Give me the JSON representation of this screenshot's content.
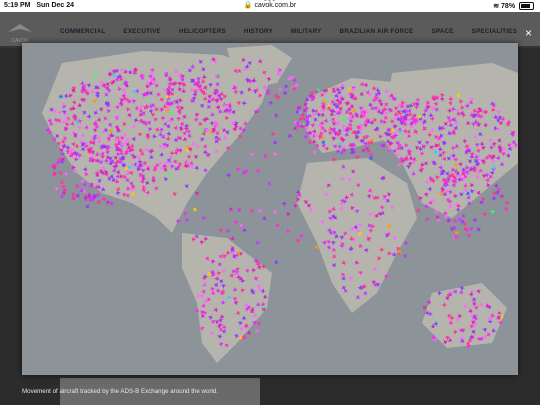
{
  "status_bar": {
    "time": "5:19 PM",
    "date": "Sun Dec 24",
    "url": "cavok.com.br",
    "battery": "78%",
    "battery_level": 0.78
  },
  "site": {
    "logo_text": "CAVOK",
    "nav": [
      "COMMERCIAL",
      "EXECUTIVE",
      "HELICOPTERS",
      "HISTORY",
      "MILITARY",
      "BRAZILIAN AIR FORCE",
      "SPACE",
      "SPECIALITIES"
    ]
  },
  "lightbox": {
    "close_label": "×",
    "caption": "Movement of aircraft tracked by the ADS-B Exchange around the world."
  },
  "map": {
    "ocean_color": "#8c9399",
    "land_color": "#b5b5ad",
    "aircraft_colors": [
      "#ff2bd6",
      "#cc33ff",
      "#ff3399",
      "#9933ff",
      "#ff66ff",
      "#e020c0"
    ],
    "accent_aircraft_colors": [
      "#33ccff",
      "#33ff66",
      "#ffcc00",
      "#3366ff",
      "#ff9900"
    ]
  }
}
